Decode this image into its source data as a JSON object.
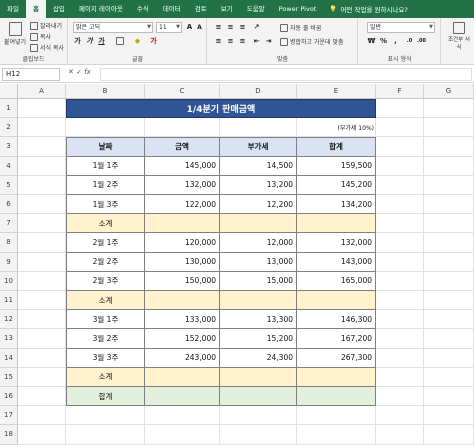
{
  "ribbon_tabs": [
    "파일",
    "홈",
    "삽입",
    "페이지 레이아웃",
    "수식",
    "데이터",
    "검토",
    "보기",
    "도움말",
    "Power Pivot"
  ],
  "active_tab": "홈",
  "tell_me": "어떤 작업을 원하시나요?",
  "clipboard": {
    "paste": "붙여넣기",
    "cut": "잘라내기",
    "copy": "복사",
    "format_painter": "서식 복사",
    "label": "클립보드"
  },
  "font": {
    "name": "맑은 고딕",
    "size": "11",
    "label": "글꼴"
  },
  "alignment": {
    "wrap": "자동 줄 바꿈",
    "merge": "병합하고 가운데 맞춤",
    "label": "맞춤"
  },
  "number": {
    "format": "일반",
    "label": "표시 형식"
  },
  "styles": {
    "conditional": "조건부 서식"
  },
  "name_box": "H12",
  "fx_symbol": "fx",
  "columns": [
    "A",
    "B",
    "C",
    "D",
    "E",
    "F",
    "G"
  ],
  "rows": [
    "1",
    "2",
    "3",
    "4",
    "5",
    "6",
    "7",
    "8",
    "9",
    "10",
    "11",
    "12",
    "13",
    "14",
    "15",
    "16",
    "17",
    "18"
  ],
  "sheet": {
    "title": "1/4분기 판매금액",
    "unit_note": "(부가세 10%)",
    "headers": [
      "날짜",
      "금액",
      "부가세",
      "합계"
    ],
    "body": [
      {
        "type": "data",
        "cells": [
          "1월 1주",
          "145,000",
          "14,500",
          "159,500"
        ]
      },
      {
        "type": "data",
        "cells": [
          "1월 2주",
          "132,000",
          "13,200",
          "145,200"
        ]
      },
      {
        "type": "data",
        "cells": [
          "1월 3주",
          "122,000",
          "12,200",
          "134,200"
        ]
      },
      {
        "type": "subtotal",
        "cells": [
          "소계",
          "",
          "",
          ""
        ]
      },
      {
        "type": "data",
        "cells": [
          "2월 1주",
          "120,000",
          "12,000",
          "132,000"
        ]
      },
      {
        "type": "data",
        "cells": [
          "2월 2주",
          "130,000",
          "13,000",
          "143,000"
        ]
      },
      {
        "type": "data",
        "cells": [
          "2월 3주",
          "150,000",
          "15,000",
          "165,000"
        ]
      },
      {
        "type": "subtotal",
        "cells": [
          "소계",
          "",
          "",
          ""
        ]
      },
      {
        "type": "data",
        "cells": [
          "3월 1주",
          "133,000",
          "13,300",
          "146,300"
        ]
      },
      {
        "type": "data",
        "cells": [
          "3월 2주",
          "152,000",
          "15,200",
          "167,200"
        ]
      },
      {
        "type": "data",
        "cells": [
          "3월 3주",
          "243,000",
          "24,300",
          "267,300"
        ]
      },
      {
        "type": "subtotal",
        "cells": [
          "소계",
          "",
          "",
          ""
        ]
      },
      {
        "type": "total",
        "cells": [
          "합계",
          "",
          "",
          ""
        ]
      }
    ]
  },
  "colors": {
    "excel_green": "#217346",
    "title_fill": "#2f5597",
    "header_fill": "#dae3f3",
    "subtotal_fill": "#fff2cc",
    "total_fill": "#e2efda"
  }
}
